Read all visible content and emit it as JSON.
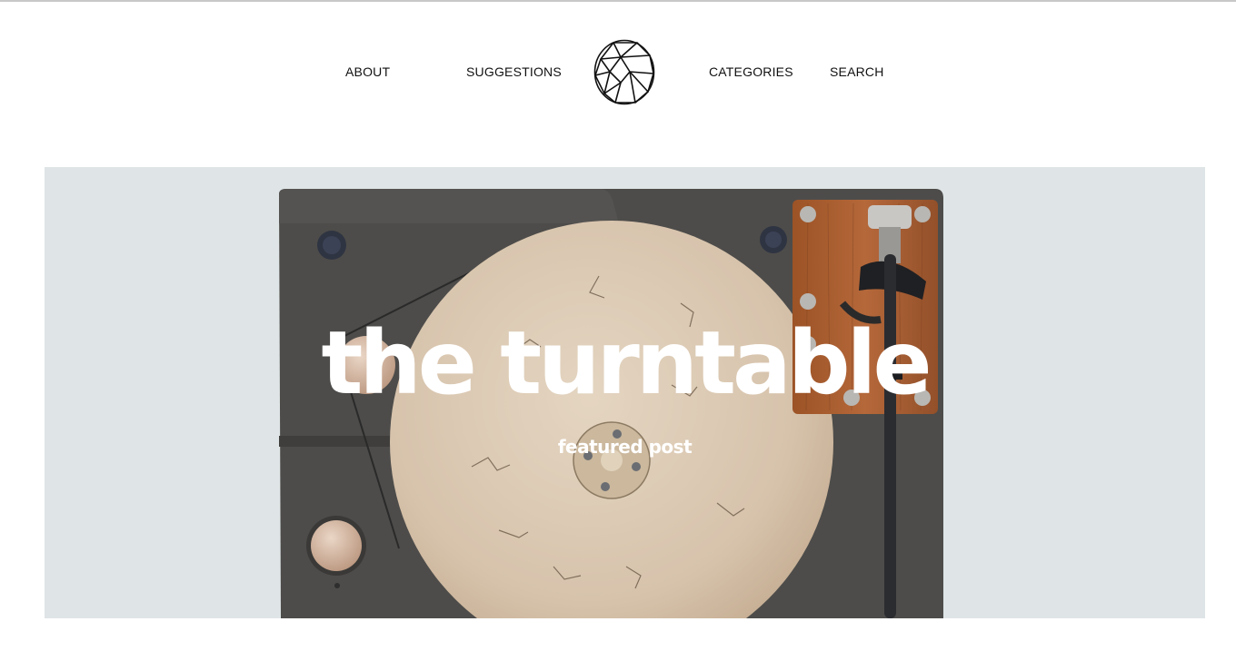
{
  "nav": {
    "about": "ABOUT",
    "suggestions": "SUGGESTIONS",
    "categories": "CATEGORIES",
    "search": "SEARCH"
  },
  "logo": {
    "icon": "geometric-circle-logo"
  },
  "hero": {
    "title": "the turntable",
    "subtitle": "featured post",
    "image": "turntable-top-view"
  },
  "colors": {
    "hero_background": "#dfe5e6",
    "plinth": "#4e4d4b",
    "platter": "#d8c6b0",
    "wood_armboard": "#a55c2c",
    "text_on_image": "#ffffff"
  }
}
